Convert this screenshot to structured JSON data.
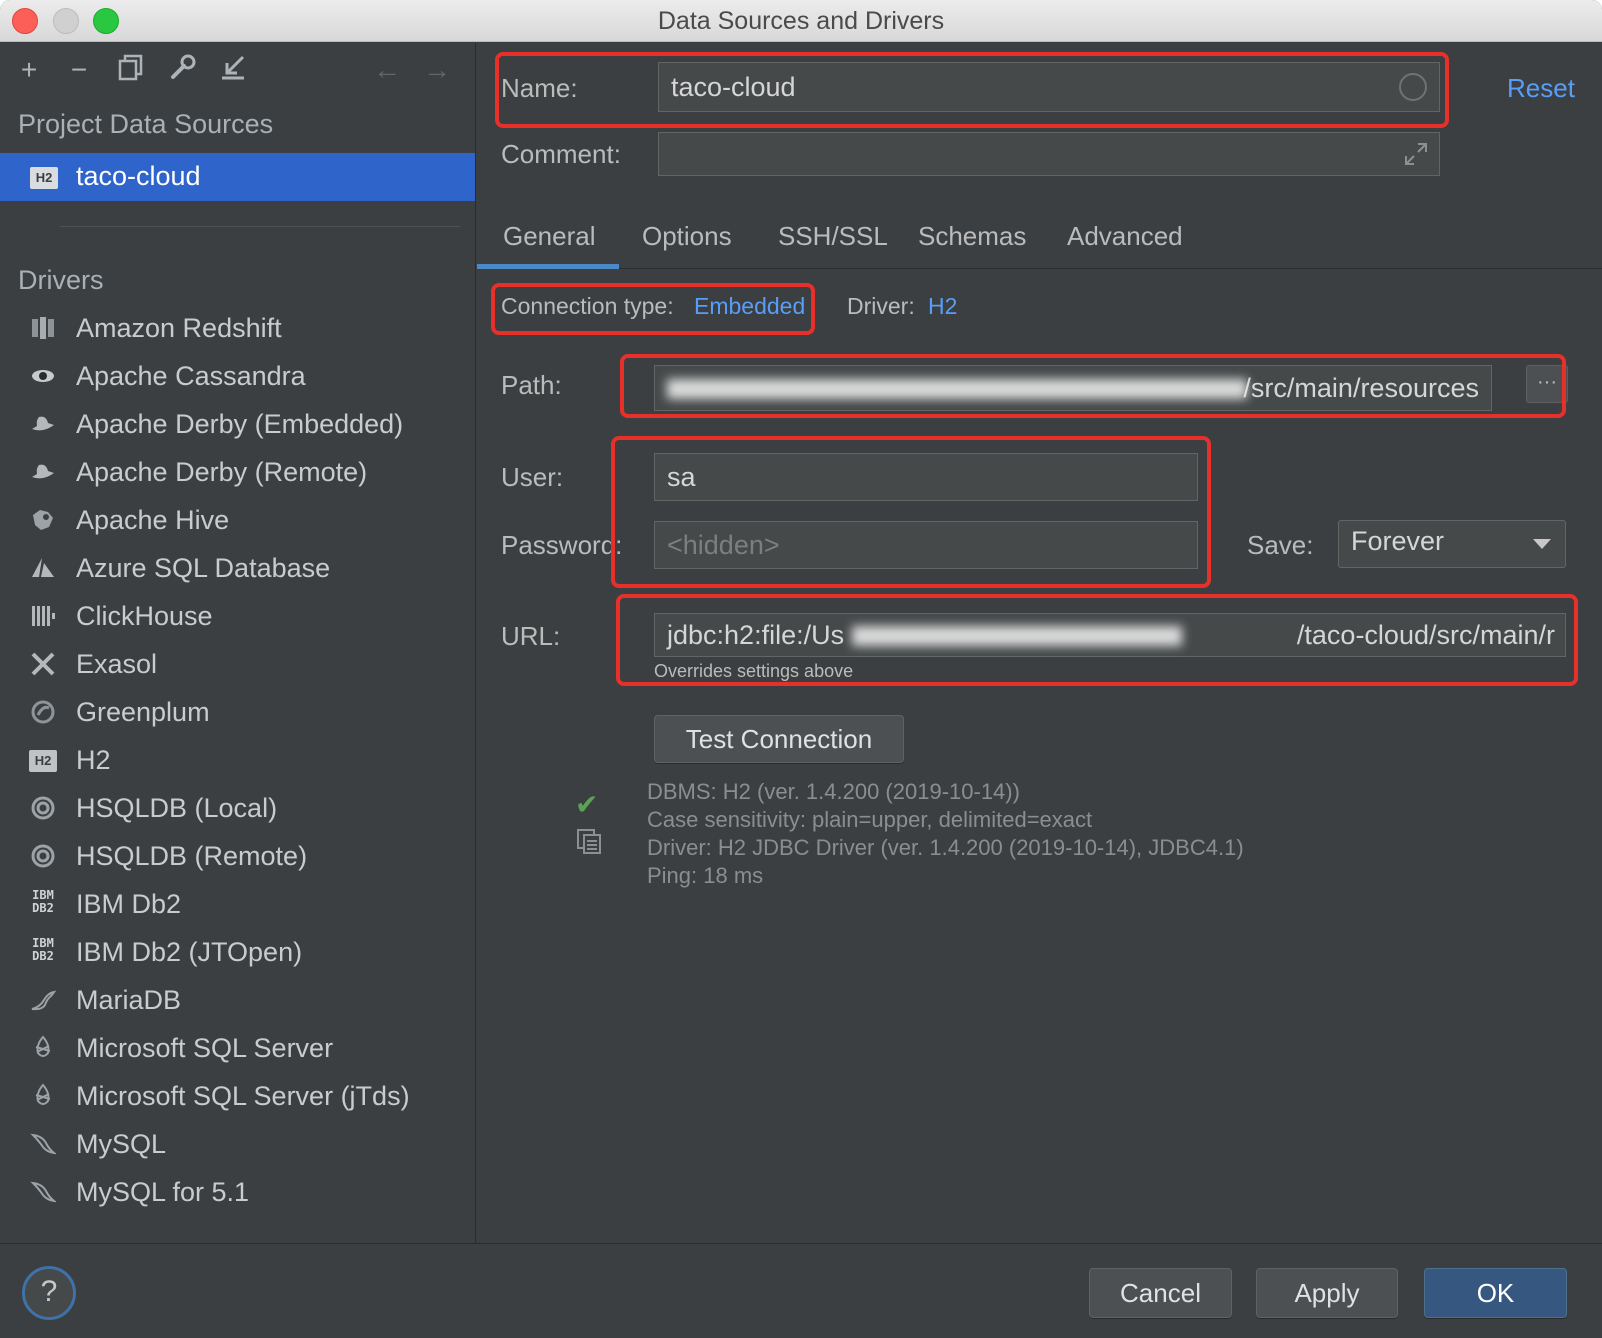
{
  "window": {
    "title": "Data Sources and Drivers"
  },
  "sidebar": {
    "project_title": "Project Data Sources",
    "selected_source": "taco-cloud",
    "selected_source_badge": "H2",
    "drivers_title": "Drivers",
    "drivers": [
      {
        "label": "Amazon Redshift",
        "icon": "redshift-icon"
      },
      {
        "label": "Apache Cassandra",
        "icon": "cassandra-eye-icon"
      },
      {
        "label": "Apache Derby (Embedded)",
        "icon": "derby-hat-icon"
      },
      {
        "label": "Apache Derby (Remote)",
        "icon": "derby-hat-icon"
      },
      {
        "label": "Apache Hive",
        "icon": "hive-icon"
      },
      {
        "label": "Azure SQL Database",
        "icon": "azure-icon"
      },
      {
        "label": "ClickHouse",
        "icon": "clickhouse-icon"
      },
      {
        "label": "Exasol",
        "icon": "exasol-icon"
      },
      {
        "label": "Greenplum",
        "icon": "greenplum-icon"
      },
      {
        "label": "H2",
        "icon": "h2-icon",
        "badge": "H2"
      },
      {
        "label": "HSQLDB (Local)",
        "icon": "hsqldb-icon"
      },
      {
        "label": "HSQLDB (Remote)",
        "icon": "hsqldb-icon"
      },
      {
        "label": "IBM Db2",
        "icon": "ibm-db2-icon",
        "badge_top": "IBM",
        "badge_bottom": "DB2"
      },
      {
        "label": "IBM Db2 (JTOpen)",
        "icon": "ibm-db2-icon",
        "badge_top": "IBM",
        "badge_bottom": "DB2"
      },
      {
        "label": "MariaDB",
        "icon": "mariadb-seal-icon"
      },
      {
        "label": "Microsoft SQL Server",
        "icon": "mssql-icon"
      },
      {
        "label": "Microsoft SQL Server (jTds)",
        "icon": "mssql-icon"
      },
      {
        "label": "MySQL",
        "icon": "mysql-dolphin-icon"
      },
      {
        "label": "MySQL for 5.1",
        "icon": "mysql-dolphin-icon"
      }
    ]
  },
  "form": {
    "name_label": "Name:",
    "name_value": "taco-cloud",
    "reset_label": "Reset",
    "comment_label": "Comment:",
    "comment_value": "",
    "tabs": [
      "General",
      "Options",
      "SSH/SSL",
      "Schemas",
      "Advanced"
    ],
    "active_tab": "General",
    "connection_type_label": "Connection type:",
    "connection_type_value": "Embedded",
    "driver_label": "Driver:",
    "driver_value": "H2",
    "path_label": "Path:",
    "path_value": "/src/main/resources",
    "path_browse": "···",
    "user_label": "User:",
    "user_value": "sa",
    "password_label": "Password:",
    "password_placeholder": "<hidden>",
    "save_label": "Save:",
    "save_value": "Forever",
    "url_label": "URL:",
    "url_value_start": "jdbc:h2:file:/Us",
    "url_value_end": "/taco-cloud/src/main/r",
    "url_hint": "Overrides settings above",
    "test_connection": "Test Connection",
    "info_lines": [
      "DBMS: H2 (ver. 1.4.200 (2019-10-14))",
      "Case sensitivity: plain=upper, delimited=exact",
      "Driver: H2 JDBC Driver (ver. 1.4.200 (2019-10-14), JDBC4.1)",
      "Ping: 18 ms"
    ]
  },
  "footer": {
    "help": "?",
    "cancel": "Cancel",
    "apply": "Apply",
    "ok": "OK"
  },
  "colors": {
    "background": "#3c3f41",
    "selection": "#2f65ca",
    "link": "#589df6",
    "highlight_box": "#e8302b",
    "success": "#5aa355",
    "primary_button": "#365880"
  }
}
